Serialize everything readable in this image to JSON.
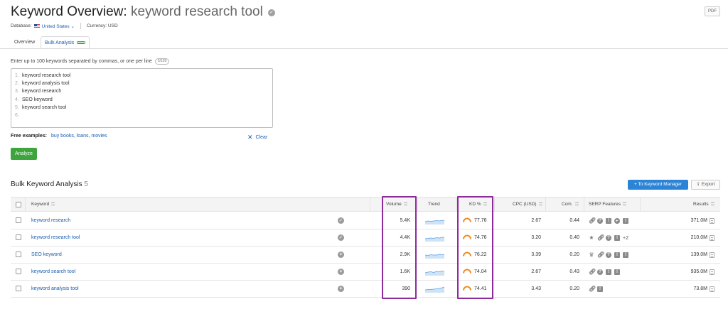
{
  "header": {
    "title": "Keyword Overview:",
    "keyword": "keyword research tool",
    "pdf_label": "PDF",
    "database_label": "Database:",
    "database_value": "United States",
    "currency": "Currency: USD"
  },
  "tabs": [
    {
      "label": "Overview"
    },
    {
      "label": "Bulk Analysis"
    }
  ],
  "input": {
    "hint": "Enter up to 100 keywords separated by commas, or one per line",
    "counter": "5/100",
    "lines": [
      {
        "n": "1.",
        "text": "keyword research tool"
      },
      {
        "n": "2.",
        "text": "keyword analysis tool"
      },
      {
        "n": "3.",
        "text": "keyword research"
      },
      {
        "n": "4.",
        "text": "SEO keyword"
      },
      {
        "n": "5.",
        "text": "keyword search tool"
      },
      {
        "n": "6.",
        "text": ""
      }
    ],
    "free_examples_label": "Free examples:",
    "free_examples_links": "buy books, loans, movies",
    "clear_label": "Clear",
    "analyze_label": "Analyze"
  },
  "bulk": {
    "title": "Bulk Keyword Analysis",
    "count": "5",
    "to_keyword_manager": "To Keyword Manager",
    "export": "Export",
    "columns": {
      "keyword": "Keyword",
      "volume": "Volume",
      "trend": "Trend",
      "kd": "KD %",
      "cpc": "CPC (USD)",
      "com": "Com.",
      "serp": "SERP Features",
      "results": "Results"
    },
    "rows": [
      {
        "keyword": "keyword research",
        "status": "check",
        "volume": "5.4K",
        "kd": "77.76",
        "cpc": "2.67",
        "com": "0.44",
        "results": "371.0M",
        "serp_extra": ""
      },
      {
        "keyword": "keyword research tool",
        "status": "check",
        "volume": "4.4K",
        "kd": "74.76",
        "cpc": "3.20",
        "com": "0.40",
        "results": "210.0M",
        "serp_extra": "+2"
      },
      {
        "keyword": "SEO keyword",
        "status": "plus",
        "volume": "2.9K",
        "kd": "76.22",
        "cpc": "3.39",
        "com": "0.20",
        "results": "139.0M",
        "serp_extra": ""
      },
      {
        "keyword": "keyword search tool",
        "status": "plus",
        "volume": "1.6K",
        "kd": "74.04",
        "cpc": "2.67",
        "com": "0.43",
        "results": "935.0M",
        "serp_extra": ""
      },
      {
        "keyword": "keyword analysis tool",
        "status": "plus",
        "volume": "390",
        "kd": "74.41",
        "cpc": "3.43",
        "com": "0.20",
        "results": "73.8M",
        "serp_extra": ""
      }
    ]
  },
  "colors": {
    "link": "#1a5cad",
    "analyze_green": "#3ea53e",
    "primary_blue": "#2b84d6",
    "highlight_purple": "#8e2a9c",
    "kd_orange": "#f08a24"
  }
}
